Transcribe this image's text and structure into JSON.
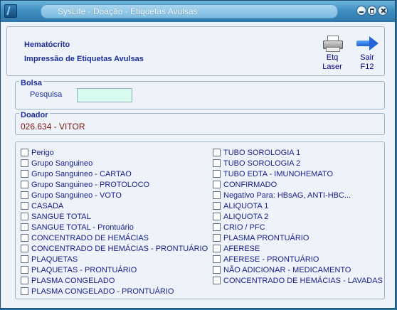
{
  "window": {
    "title": "SysLife - Doação - Etiquetas Avulsas"
  },
  "header": {
    "line1": "Hematócrito",
    "line2": "Impressão de Etiquetas Avulsas",
    "tools": [
      {
        "icon": "printer-icon",
        "line1": "Etq",
        "line2": "Laser"
      },
      {
        "icon": "arrow-right-icon",
        "line1": "Sair",
        "line2": "F12"
      }
    ]
  },
  "bolsa": {
    "title": "Bolsa",
    "search_label": "Pesquisa",
    "search_value": ""
  },
  "doador": {
    "title": "Doador",
    "value": "026.634 - VITOR"
  },
  "labels_left": [
    "Perigo",
    "Grupo Sanguineo",
    "Grupo Sanguineo - CARTAO",
    "Grupo Sanguineo - PROTOLOCO",
    "Grupo Sanguineo - VOTO",
    "CASADA",
    "SANGUE TOTAL",
    "SANGUE TOTAL - Prontuário",
    "CONCENTRADO DE HEMÁCIAS",
    "CONCENTRADO DE HEMÁCIAS - PRONTUÁRIO",
    "PLAQUETAS",
    "PLAQUETAS - PRONTUÁRIO",
    "PLASMA CONGELADO",
    "PLASMA CONGELADO - PRONTUÁRIO"
  ],
  "labels_right": [
    "TUBO SOROLOGIA 1",
    "TUBO SOROLOGIA 2",
    "TUBO EDTA - IMUNOHEMATO",
    "CONFIRMADO",
    "Negativo Para: HBsAG, ANTI-HBC...",
    "ALIQUOTA 1",
    "ALIQUOTA 2",
    "CRIO  /  PFC",
    "PLASMA PRONTUÁRIO",
    "AFERESE",
    "AFERESE - PRONTUÁRIO",
    "NÃO ADICIONAR - MEDICAMENTO",
    "CONCENTRADO DE HEMÁCIAS - LAVADAS"
  ]
}
